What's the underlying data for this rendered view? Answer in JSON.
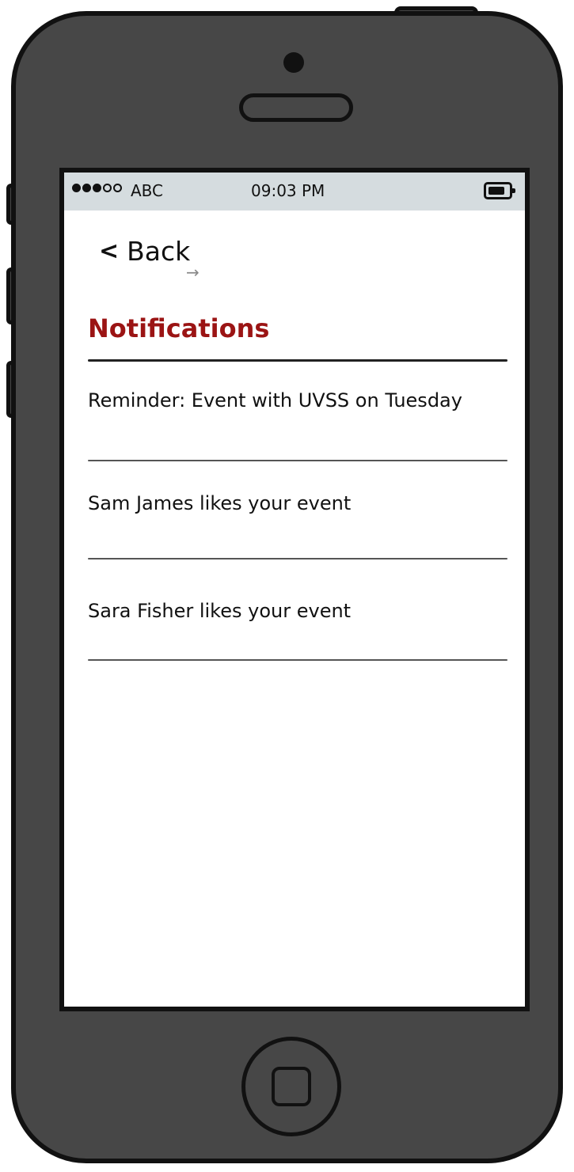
{
  "status_bar": {
    "carrier": "ABC",
    "time": "09:03 PM"
  },
  "nav": {
    "back_label": "Back"
  },
  "page": {
    "title": "Notifications"
  },
  "notifications": [
    {
      "text": "Reminder: Event with UVSS on Tuesday"
    },
    {
      "text": "Sam James likes your event"
    },
    {
      "text": "Sara Fisher likes your event"
    }
  ],
  "colors": {
    "title": "#9b1414",
    "phone_body": "#474747",
    "status_bar": "#d5dcdf"
  }
}
